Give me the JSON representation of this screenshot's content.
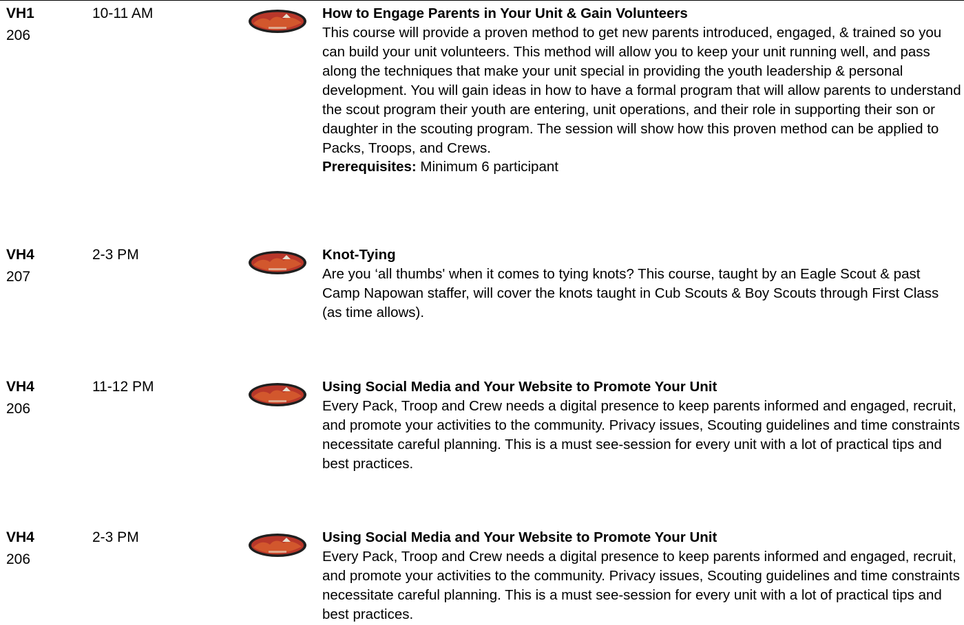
{
  "sessions": [
    {
      "code": "VH1",
      "room": "206",
      "time": "10-11 AM",
      "title": "How to Engage Parents in Your Unit & Gain Volunteers",
      "description": "This course will provide a proven method to get new parents introduced, engaged, & trained so you can build your unit volunteers. This method will allow you to keep your unit running well, and pass along the techniques that make your unit special in providing the youth leadership & personal development. You will gain ideas in how to have a formal program that will allow parents to understand the scout program their youth are entering, unit operations, and their role in supporting their son or daughter in the scouting program. The session will show how this proven method can be applied to Packs, Troops, and Crews.",
      "prereq_label": "Prerequisites:",
      "prereq_value": " Minimum 6 participant"
    },
    {
      "code": "VH4",
      "room": "207",
      "time": "2-3 PM",
      "title": "Knot-Tying",
      "description": "Are you ‘all thumbs' when it comes to tying knots? This course, taught by an Eagle Scout & past Camp Napowan staffer, will cover the knots taught in Cub Scouts & Boy Scouts through First Class (as time allows)."
    },
    {
      "code": "VH4",
      "room": "206",
      "time": "11-12 PM",
      "title": "Using Social Media and Your Website to Promote Your Unit",
      "description": "Every Pack, Troop and Crew needs a digital presence to keep parents informed and engaged, recruit, and promote your activities to the community. Privacy issues, Scouting guidelines and time constraints necessitate careful planning. This is a must see-session for every unit with a lot of practical tips and best practices."
    },
    {
      "code": "VH4",
      "room": "206",
      "time": "2-3 PM",
      "title": "Using Social Media and Your Website to Promote Your Unit",
      "description": "Every Pack, Troop and Crew needs a digital presence to keep parents informed and engaged, recruit, and promote your activities to the community. Privacy issues, Scouting guidelines and time constraints necessitate careful planning. This is a must see-session for every unit with a lot of practical tips and best practices."
    }
  ],
  "patch": {
    "icon": "council-patch-icon",
    "colors": {
      "border": "#1f1f1f",
      "sky": "#b8372a",
      "rock": "#d2572d",
      "accent": "#e8e0d0"
    }
  }
}
